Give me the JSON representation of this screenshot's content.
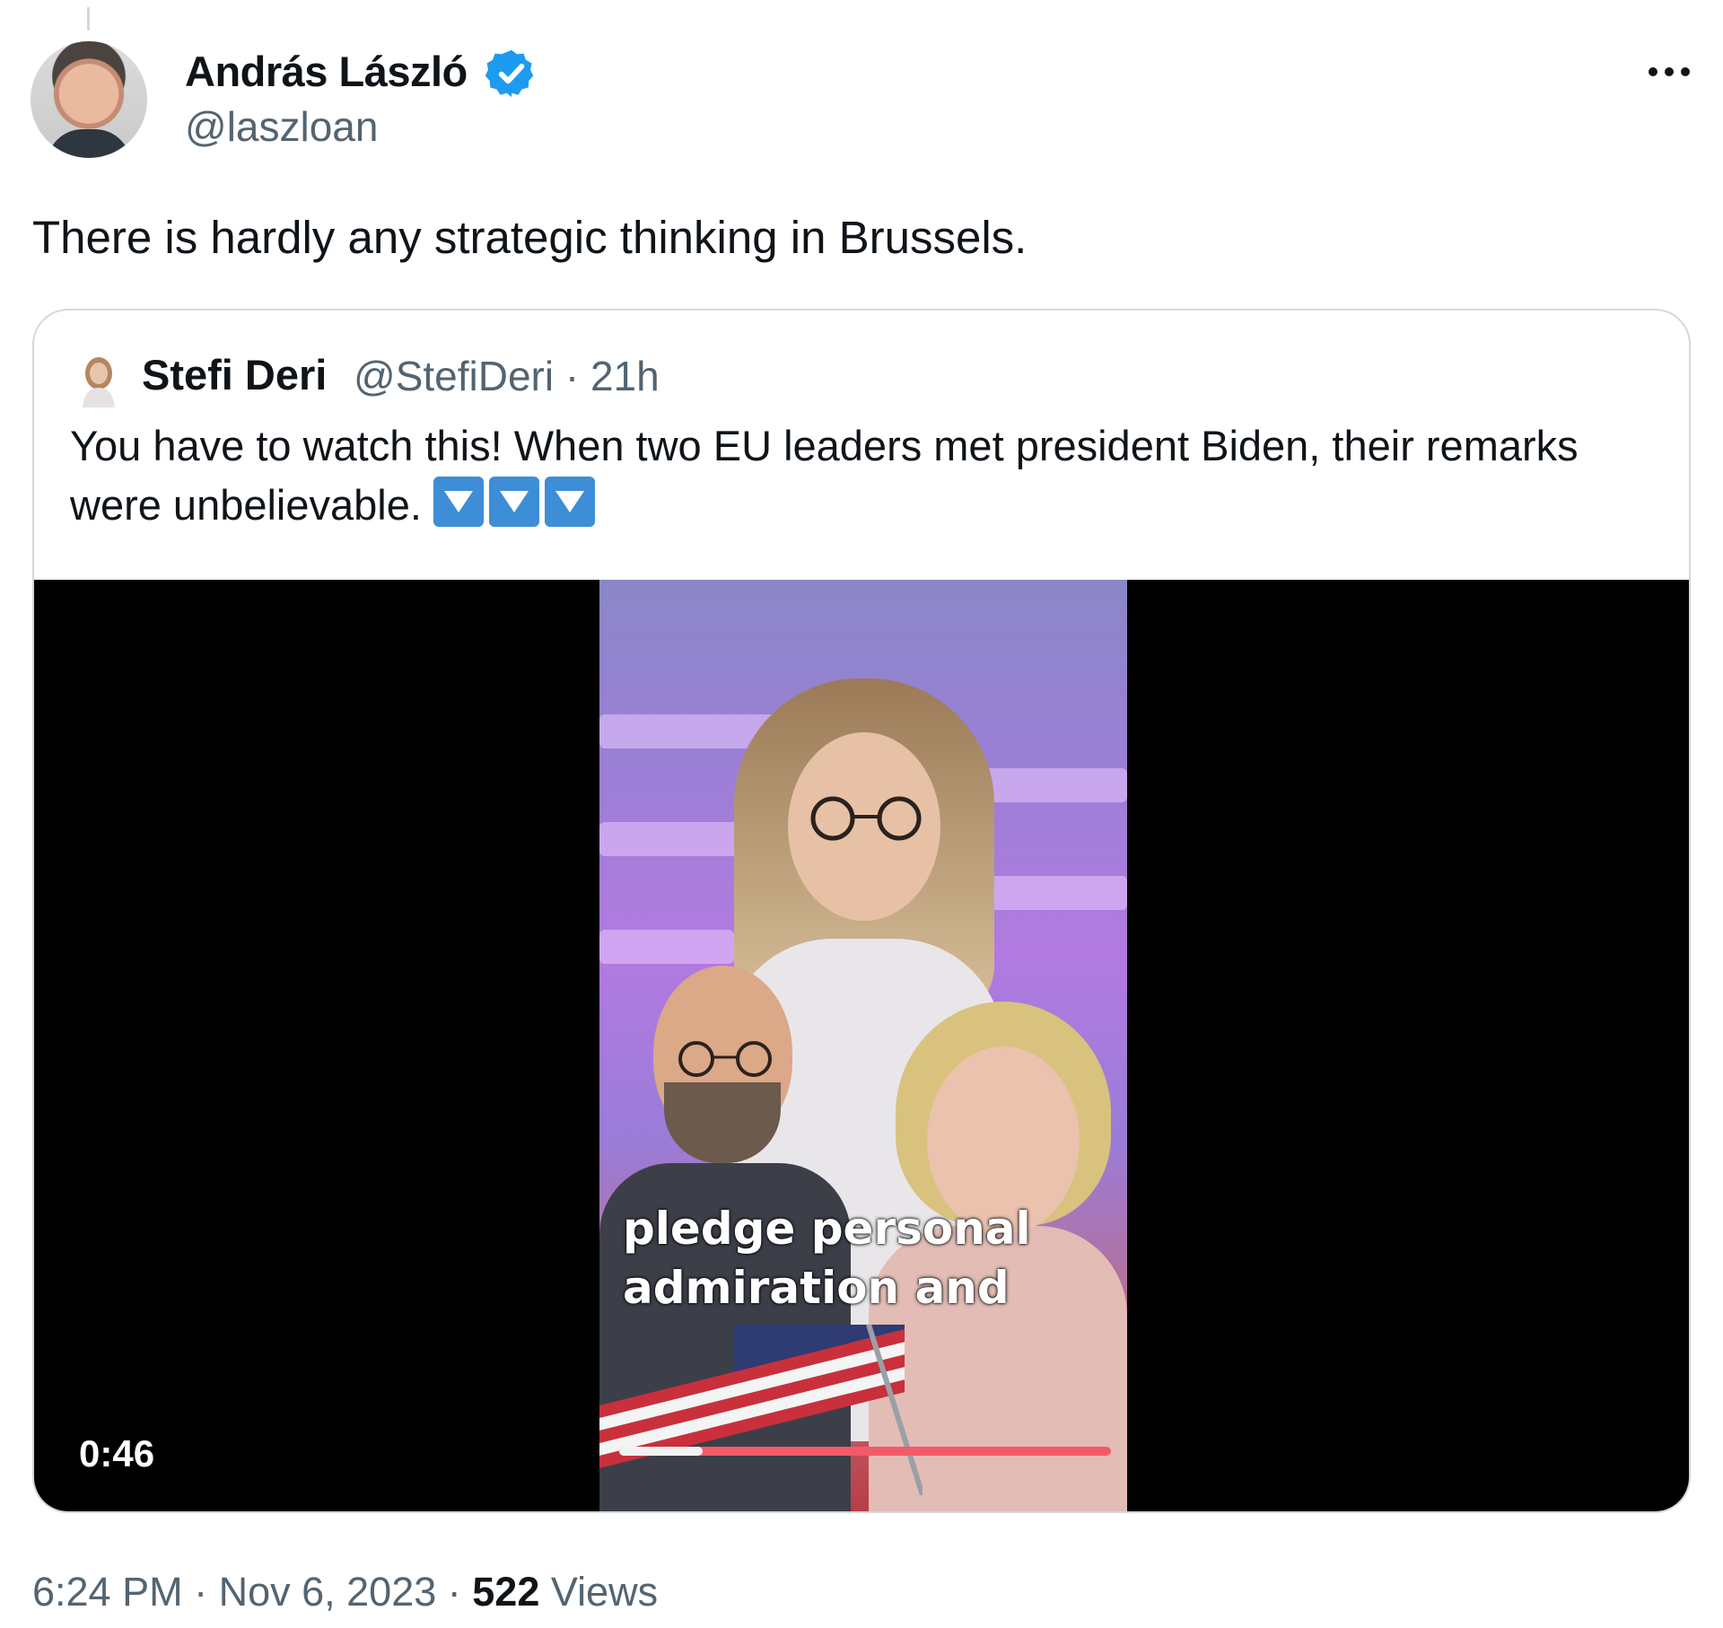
{
  "tweet": {
    "author_name": "András László",
    "author_handle": "@laszloan",
    "text": "There is hardly any strategic thinking in Brussels.",
    "time": "6:24 PM",
    "separator": " · ",
    "date": "Nov 6, 2023",
    "views_count": "522",
    "views_label": " Views"
  },
  "quoted_tweet": {
    "author_name": "Stefi Deri",
    "author_handle": "@StefiDeri · 21h",
    "text": "You have to watch this! When two EU leaders met president Biden, their remarks were unbelievable. ",
    "emoji_count": 3
  },
  "video": {
    "caption": "pledge personal admiration and",
    "duration": "0:46",
    "progress": 0.17
  },
  "colors": {
    "verified": "#1d9bf0",
    "secondary_text": "#536471",
    "border": "#cfd9de"
  },
  "icons": {
    "verified": "verified-badge-icon",
    "more": "more-options-icon",
    "arrow": "down-arrow-emoji-icon"
  }
}
